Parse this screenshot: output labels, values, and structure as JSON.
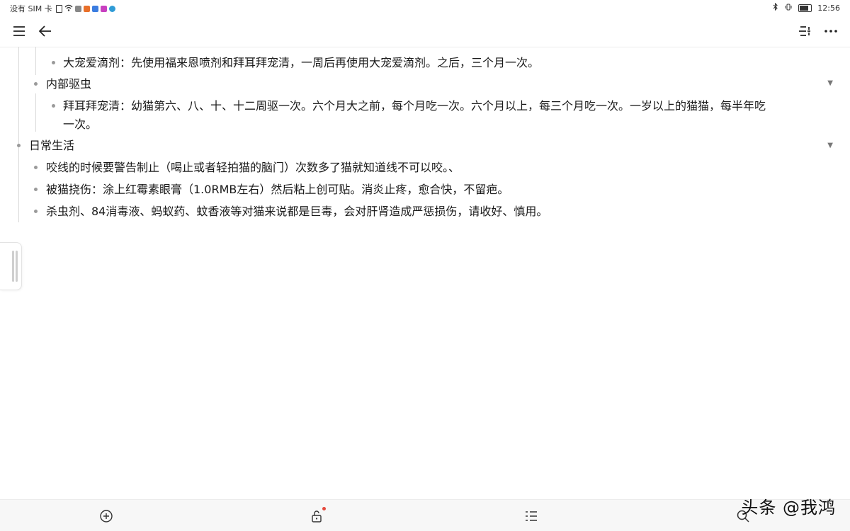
{
  "status_bar": {
    "carrier": "没有 SIM 卡",
    "time": "12:56",
    "app_icon_colors": [
      "#e8702a",
      "#3b7de0",
      "#c840c0",
      "#2f9bd6"
    ]
  },
  "toolbar": {
    "menu_icon": "hamburger-menu-icon",
    "back_icon": "back-arrow-icon",
    "outline_icon": "outline-toggle-icon",
    "more_icon": "more-options-icon"
  },
  "outline": {
    "dachong_drops": "大宠爱滴剂：先使用福来恩喷剂和拜耳拜宠清，一周后再使用大宠爱滴剂。之后，三个月一次。",
    "internal_deworming": {
      "title": "内部驱虫",
      "bayer_line1": "拜耳拜宠清：幼猫第六、八、十、十二周驱一次。六个月大之前，每个月吃一次。六个月以上，每三个月吃一次。一岁以上的猫猫，每半年吃",
      "bayer_line2": "一次。"
    },
    "daily_life": {
      "title": "日常生活",
      "items": [
        "咬线的时候要警告制止（喝止或者轻拍猫的脑门）次数多了猫就知道线不可以咬。、",
        "被猫挠伤：涂上红霉素眼膏（1.0RMB左右）然后粘上创可贴。消炎止疼，愈合快，不留疤。",
        "杀虫剂、84消毒液、蚂蚁药、蚊香液等对猫来说都是巨毒，会对肝肾造成严惩损伤，请收好、慎用。"
      ]
    }
  },
  "bottom_bar": {
    "add_icon": "add-circle-icon",
    "lock_icon": "unlock-icon",
    "format_icon": "list-format-icon",
    "search_icon": "search-icon",
    "notification_color": "#e5483c"
  },
  "watermark": "头条 @我鸿"
}
